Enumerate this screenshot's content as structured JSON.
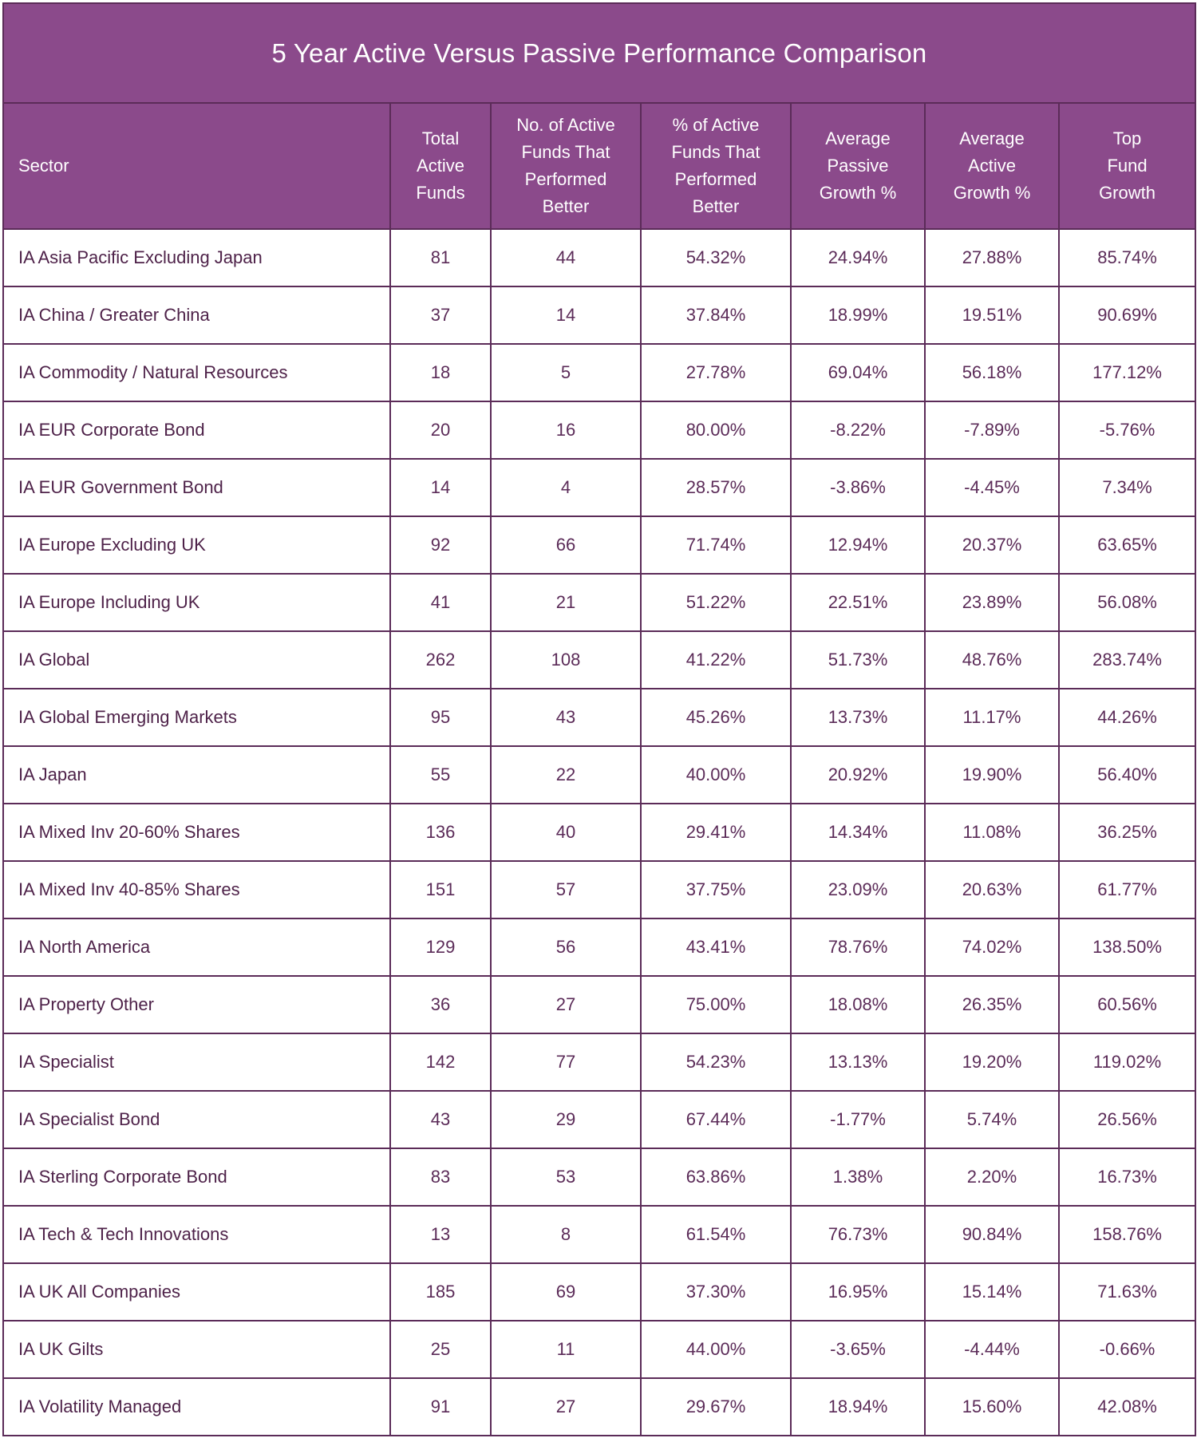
{
  "table": {
    "title": "5 Year Active Versus Passive Performance Comparison",
    "headers": [
      {
        "lines": [
          "Sector"
        ]
      },
      {
        "lines": [
          "Total",
          "Active",
          "Funds"
        ]
      },
      {
        "lines": [
          "No. of Active",
          "Funds That",
          "Performed",
          "Better"
        ]
      },
      {
        "lines": [
          "% of Active",
          "Funds That",
          "Performed",
          "Better"
        ]
      },
      {
        "lines": [
          "Average",
          "Passive",
          "Growth %"
        ]
      },
      {
        "lines": [
          "Average",
          "Active",
          "Growth %"
        ]
      },
      {
        "lines": [
          "Top",
          "Fund",
          "Growth"
        ]
      }
    ],
    "rows": [
      [
        "IA Asia Pacific Excluding Japan",
        "81",
        "44",
        "54.32%",
        "24.94%",
        "27.88%",
        "85.74%"
      ],
      [
        "IA China / Greater China",
        "37",
        "14",
        "37.84%",
        "18.99%",
        "19.51%",
        "90.69%"
      ],
      [
        "IA Commodity / Natural Resources",
        "18",
        "5",
        "27.78%",
        "69.04%",
        "56.18%",
        "177.12%"
      ],
      [
        "IA EUR Corporate Bond",
        "20",
        "16",
        "80.00%",
        "-8.22%",
        "-7.89%",
        "-5.76%"
      ],
      [
        "IA EUR Government Bond",
        "14",
        "4",
        "28.57%",
        "-3.86%",
        "-4.45%",
        "7.34%"
      ],
      [
        "IA Europe Excluding UK",
        "92",
        "66",
        "71.74%",
        "12.94%",
        "20.37%",
        "63.65%"
      ],
      [
        "IA Europe Including UK",
        "41",
        "21",
        "51.22%",
        "22.51%",
        "23.89%",
        "56.08%"
      ],
      [
        "IA Global",
        "262",
        "108",
        "41.22%",
        "51.73%",
        "48.76%",
        "283.74%"
      ],
      [
        "IA Global Emerging Markets",
        "95",
        "43",
        "45.26%",
        "13.73%",
        "11.17%",
        "44.26%"
      ],
      [
        "IA Japan",
        "55",
        "22",
        "40.00%",
        "20.92%",
        "19.90%",
        "56.40%"
      ],
      [
        "IA Mixed Inv 20-60% Shares",
        "136",
        "40",
        "29.41%",
        "14.34%",
        "11.08%",
        "36.25%"
      ],
      [
        "IA Mixed Inv 40-85% Shares",
        "151",
        "57",
        "37.75%",
        "23.09%",
        "20.63%",
        "61.77%"
      ],
      [
        "IA North America",
        "129",
        "56",
        "43.41%",
        "78.76%",
        "74.02%",
        "138.50%"
      ],
      [
        "IA Property Other",
        "36",
        "27",
        "75.00%",
        "18.08%",
        "26.35%",
        "60.56%"
      ],
      [
        "IA Specialist",
        "142",
        "77",
        "54.23%",
        "13.13%",
        "19.20%",
        "119.02%"
      ],
      [
        "IA Specialist Bond",
        "43",
        "29",
        "67.44%",
        "-1.77%",
        "5.74%",
        "26.56%"
      ],
      [
        "IA Sterling Corporate Bond",
        "83",
        "53",
        "63.86%",
        "1.38%",
        "2.20%",
        "16.73%"
      ],
      [
        "IA Tech & Tech Innovations",
        "13",
        "8",
        "61.54%",
        "76.73%",
        "90.84%",
        "158.76%"
      ],
      [
        "IA UK All Companies",
        "185",
        "69",
        "37.30%",
        "16.95%",
        "15.14%",
        "71.63%"
      ],
      [
        "IA UK Gilts",
        "25",
        "11",
        "44.00%",
        "-3.65%",
        "-4.44%",
        "-0.66%"
      ],
      [
        "IA Volatility Managed",
        "91",
        "27",
        "29.67%",
        "18.94%",
        "15.60%",
        "42.08%"
      ]
    ]
  },
  "colors": {
    "header_bg": "#8b4a8b",
    "border": "#5b2b58",
    "body_text": "#5b2b58",
    "header_text": "#ffffff"
  }
}
